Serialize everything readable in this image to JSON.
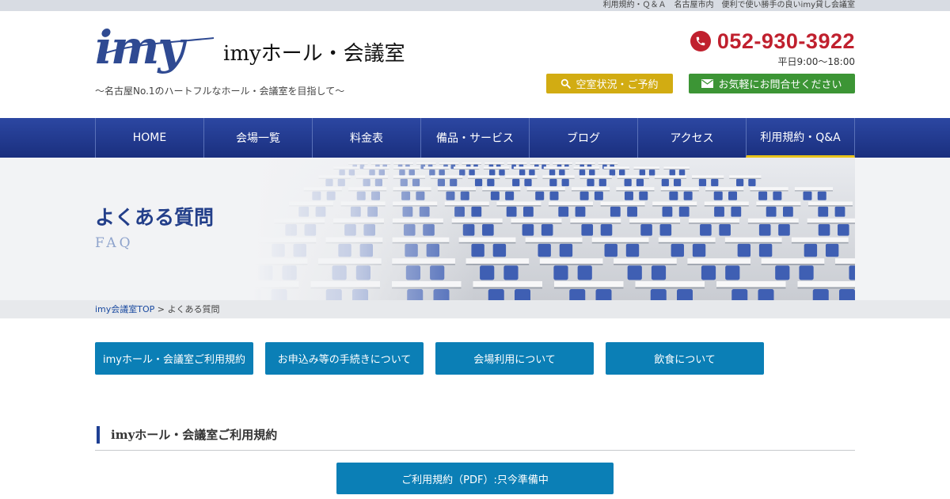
{
  "topbar": {
    "text": "利用規約・Ｑ＆Ａ　名古屋市内　便利で使い勝手の良いimy貸し会議室"
  },
  "header": {
    "logo_mark": "imy",
    "logo_name": "imyホール・会議室",
    "tagline": "～名古屋No.1のハートフルなホール・会議室を目指して～",
    "phone": "052-930-3922",
    "hours": "平日9:00～18:00",
    "reserve_label": "空室状況・ご予約",
    "contact_label": "お気軽にお問合せください"
  },
  "nav": {
    "items": [
      "HOME",
      "会場一覧",
      "料金表",
      "備品・サービス",
      "ブログ",
      "アクセス",
      "利用規約・Q&A"
    ],
    "active_index": 6
  },
  "hero": {
    "title": "よくある質問",
    "subtitle": "FAQ"
  },
  "breadcrumb": {
    "home": "imy会議室TOP",
    "separator": " > ",
    "current": "よくある質問"
  },
  "tabs": [
    "imyホール・会議室ご利用規約",
    "お申込み等の手続きについて",
    "会場利用について",
    "飲食について"
  ],
  "section": {
    "heading": "imyホール・会議室ご利用規約",
    "pdf_label": "ご利用規約（PDF）:只今準備中"
  },
  "colors": {
    "brand_blue": "#233f8a",
    "nav_blue": "#1f3a8f",
    "phone_red": "#c0202e",
    "reserve_yellow": "#d2ac12",
    "contact_green": "#3c9535",
    "tab_blue": "#0b7fb6",
    "active_underline": "#e8c21a"
  },
  "icons": {
    "phone": "phone-icon",
    "search": "search-icon",
    "mail": "mail-icon"
  }
}
